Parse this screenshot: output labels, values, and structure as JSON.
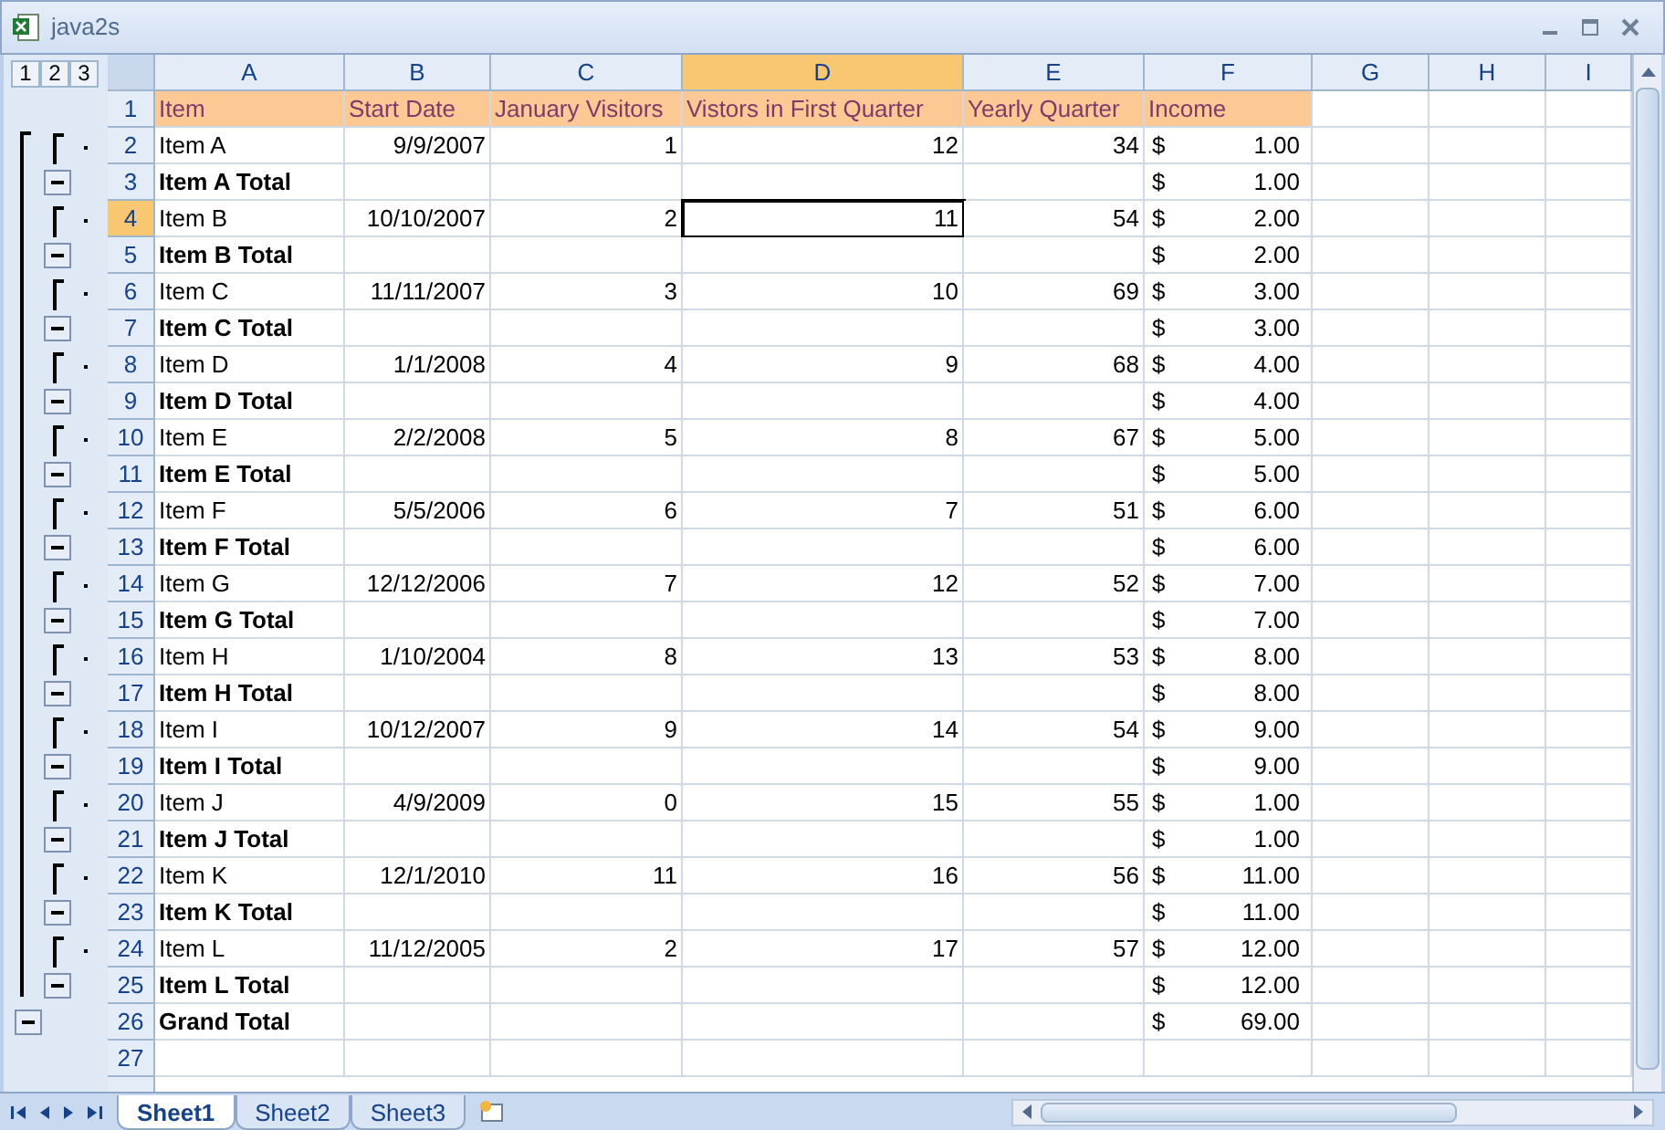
{
  "window": {
    "title": "java2s"
  },
  "outline_levels": [
    "1",
    "2",
    "3"
  ],
  "columns": [
    {
      "label": "A",
      "selected": false
    },
    {
      "label": "B",
      "selected": false
    },
    {
      "label": "C",
      "selected": false
    },
    {
      "label": "D",
      "selected": true
    },
    {
      "label": "E",
      "selected": false
    },
    {
      "label": "F",
      "selected": false
    },
    {
      "label": "G",
      "selected": false
    },
    {
      "label": "H",
      "selected": false
    },
    {
      "label": "I",
      "selected": false
    }
  ],
  "rows": [
    {
      "number": "1",
      "kind": "header",
      "selected": false,
      "cells": [
        "Item",
        "Start Date",
        "January Visitors",
        "Vistors in First Quarter",
        "Yearly Quarter",
        "Income"
      ]
    },
    {
      "number": "2",
      "kind": "item",
      "selected": false,
      "cells": [
        "Item A",
        "9/9/2007",
        "1",
        "12",
        "34"
      ],
      "currency": "$",
      "income": "1.00"
    },
    {
      "number": "3",
      "kind": "total",
      "selected": false,
      "cells": [
        "Item A Total"
      ],
      "currency": "$",
      "income": "1.00"
    },
    {
      "number": "4",
      "kind": "item",
      "selected": true,
      "cells": [
        "Item B",
        "10/10/2007",
        "2",
        "11",
        "54"
      ],
      "currency": "$",
      "income": "2.00"
    },
    {
      "number": "5",
      "kind": "total",
      "selected": false,
      "cells": [
        "Item B Total"
      ],
      "currency": "$",
      "income": "2.00"
    },
    {
      "number": "6",
      "kind": "item",
      "selected": false,
      "cells": [
        "Item C",
        "11/11/2007",
        "3",
        "10",
        "69"
      ],
      "currency": "$",
      "income": "3.00"
    },
    {
      "number": "7",
      "kind": "total",
      "selected": false,
      "cells": [
        "Item C Total"
      ],
      "currency": "$",
      "income": "3.00"
    },
    {
      "number": "8",
      "kind": "item",
      "selected": false,
      "cells": [
        "Item D",
        "1/1/2008",
        "4",
        "9",
        "68"
      ],
      "currency": "$",
      "income": "4.00"
    },
    {
      "number": "9",
      "kind": "total",
      "selected": false,
      "cells": [
        "Item D Total"
      ],
      "currency": "$",
      "income": "4.00"
    },
    {
      "number": "10",
      "kind": "item",
      "selected": false,
      "cells": [
        "Item E",
        "2/2/2008",
        "5",
        "8",
        "67"
      ],
      "currency": "$",
      "income": "5.00"
    },
    {
      "number": "11",
      "kind": "total",
      "selected": false,
      "cells": [
        "Item E Total"
      ],
      "currency": "$",
      "income": "5.00"
    },
    {
      "number": "12",
      "kind": "item",
      "selected": false,
      "cells": [
        "Item F",
        "5/5/2006",
        "6",
        "7",
        "51"
      ],
      "currency": "$",
      "income": "6.00"
    },
    {
      "number": "13",
      "kind": "total",
      "selected": false,
      "cells": [
        "Item F Total"
      ],
      "currency": "$",
      "income": "6.00"
    },
    {
      "number": "14",
      "kind": "item",
      "selected": false,
      "cells": [
        "Item G",
        "12/12/2006",
        "7",
        "12",
        "52"
      ],
      "currency": "$",
      "income": "7.00"
    },
    {
      "number": "15",
      "kind": "total",
      "selected": false,
      "cells": [
        "Item G Total"
      ],
      "currency": "$",
      "income": "7.00"
    },
    {
      "number": "16",
      "kind": "item",
      "selected": false,
      "cells": [
        "Item H",
        "1/10/2004",
        "8",
        "13",
        "53"
      ],
      "currency": "$",
      "income": "8.00"
    },
    {
      "number": "17",
      "kind": "total",
      "selected": false,
      "cells": [
        "Item H Total"
      ],
      "currency": "$",
      "income": "8.00"
    },
    {
      "number": "18",
      "kind": "item",
      "selected": false,
      "cells": [
        "Item I",
        "10/12/2007",
        "9",
        "14",
        "54"
      ],
      "currency": "$",
      "income": "9.00"
    },
    {
      "number": "19",
      "kind": "total",
      "selected": false,
      "cells": [
        "Item I Total"
      ],
      "currency": "$",
      "income": "9.00"
    },
    {
      "number": "20",
      "kind": "item",
      "selected": false,
      "cells": [
        "Item J",
        "4/9/2009",
        "0",
        "15",
        "55"
      ],
      "currency": "$",
      "income": "1.00"
    },
    {
      "number": "21",
      "kind": "total",
      "selected": false,
      "cells": [
        "Item J Total"
      ],
      "currency": "$",
      "income": "1.00"
    },
    {
      "number": "22",
      "kind": "item",
      "selected": false,
      "cells": [
        "Item K",
        "12/1/2010",
        "11",
        "16",
        "56"
      ],
      "currency": "$",
      "income": "11.00"
    },
    {
      "number": "23",
      "kind": "total",
      "selected": false,
      "cells": [
        "Item K Total"
      ],
      "currency": "$",
      "income": "11.00"
    },
    {
      "number": "24",
      "kind": "item",
      "selected": false,
      "cells": [
        "Item L",
        "11/12/2005",
        "2",
        "17",
        "57"
      ],
      "currency": "$",
      "income": "12.00"
    },
    {
      "number": "25",
      "kind": "total",
      "selected": false,
      "cells": [
        "Item L Total"
      ],
      "currency": "$",
      "income": "12.00"
    },
    {
      "number": "26",
      "kind": "grand",
      "selected": false,
      "cells": [
        "Grand Total"
      ],
      "currency": "$",
      "income": "69.00"
    },
    {
      "number": "27",
      "kind": "empty",
      "selected": false,
      "cells": []
    }
  ],
  "sheet_tabs": [
    {
      "label": "Sheet1",
      "selected": true
    },
    {
      "label": "Sheet2",
      "selected": false
    },
    {
      "label": "Sheet3",
      "selected": false
    }
  ]
}
